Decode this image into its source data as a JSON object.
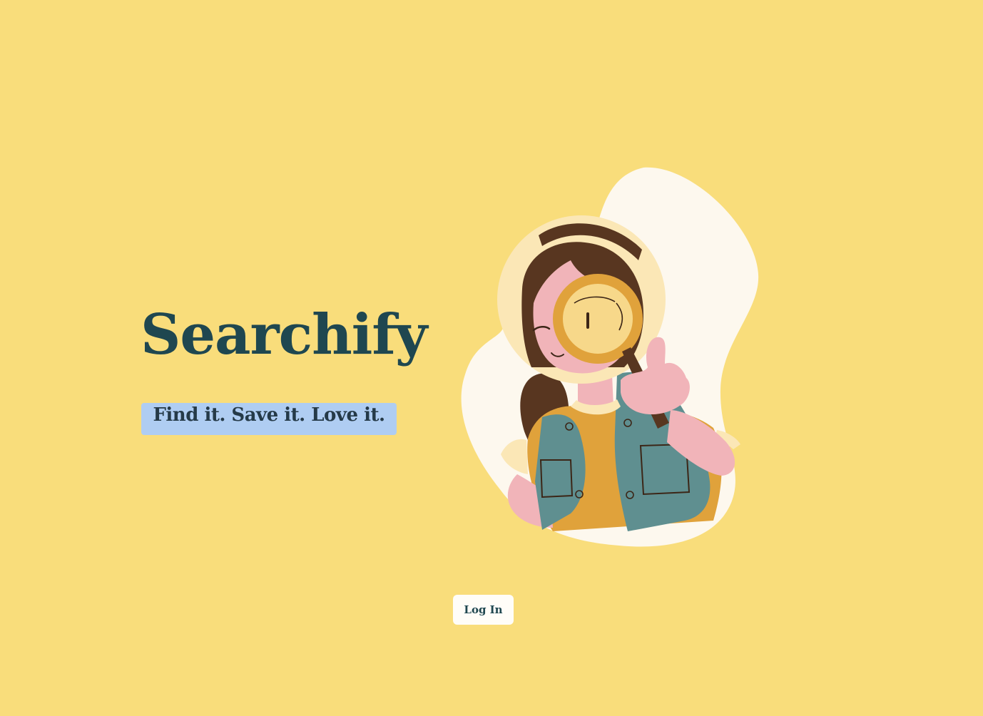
{
  "app": {
    "brand": "Searchify",
    "tagline": "Find it. Save it. Love it."
  },
  "actions": {
    "login_label": "Log In"
  },
  "colors": {
    "background": "#f9dd7b",
    "brand_text": "#1f4750",
    "tagline_highlight": "#afcdf2",
    "button_background": "#fffdf8"
  },
  "illustration": {
    "subject": "woman-with-magnifying-glass"
  }
}
